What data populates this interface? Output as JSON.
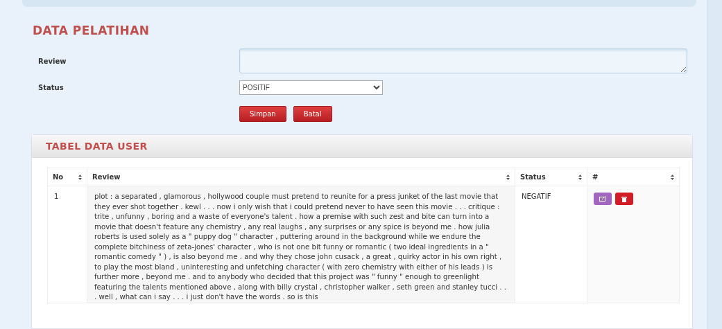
{
  "form": {
    "title": "DATA PELATIHAN",
    "review_label": "Review",
    "status_label": "Status",
    "status_value": "POSITIF",
    "buttons": [
      {
        "label": "Simpan"
      },
      {
        "label": "Batal"
      }
    ]
  },
  "table_panel": {
    "title": "TABEL DATA USER",
    "columns": [
      {
        "label": "No",
        "sortable": true
      },
      {
        "label": "Review",
        "sortable": true
      },
      {
        "label": "Status",
        "sortable": true
      },
      {
        "label": "#",
        "sortable": true
      }
    ],
    "rows": [
      {
        "no": "1",
        "review": "plot : a separated , glamorous , hollywood couple must pretend to reunite for a press junket of the last movie that they ever shot together . kewl . . . now i only wish that i could pretend never to have seen this movie . . . critique : trite , unfunny , boring and a waste of everyone's talent . how a premise with such zest and bite can turn into a movie that doesn't feature any chemistry , any real laughs , any surprises or any spice is beyond me . how julia roberts is used solely as a \" puppy dog \" character , puttering around in the background while we endure the complete bitchiness of zeta-jones' character , who is not one bit funny or romantic ( two ideal ingredients in a \" romantic comedy \" ) , is also beyond me . and why they chose john cusack , a great , quirky actor in his own right , to play the most bland , uninteresting and unfetching character ( with zero chemistry with either of his leads ) is further more , beyond me . and to anybody who decided that this project was \" funny \" enough to greenlight featuring the talents mentioned above , along with billy crystal , christopher walker , seth green and stanley tucci . . . well , what can i say . . . i just don't have the words . so is this",
        "status": "NEGATIF"
      }
    ]
  }
}
